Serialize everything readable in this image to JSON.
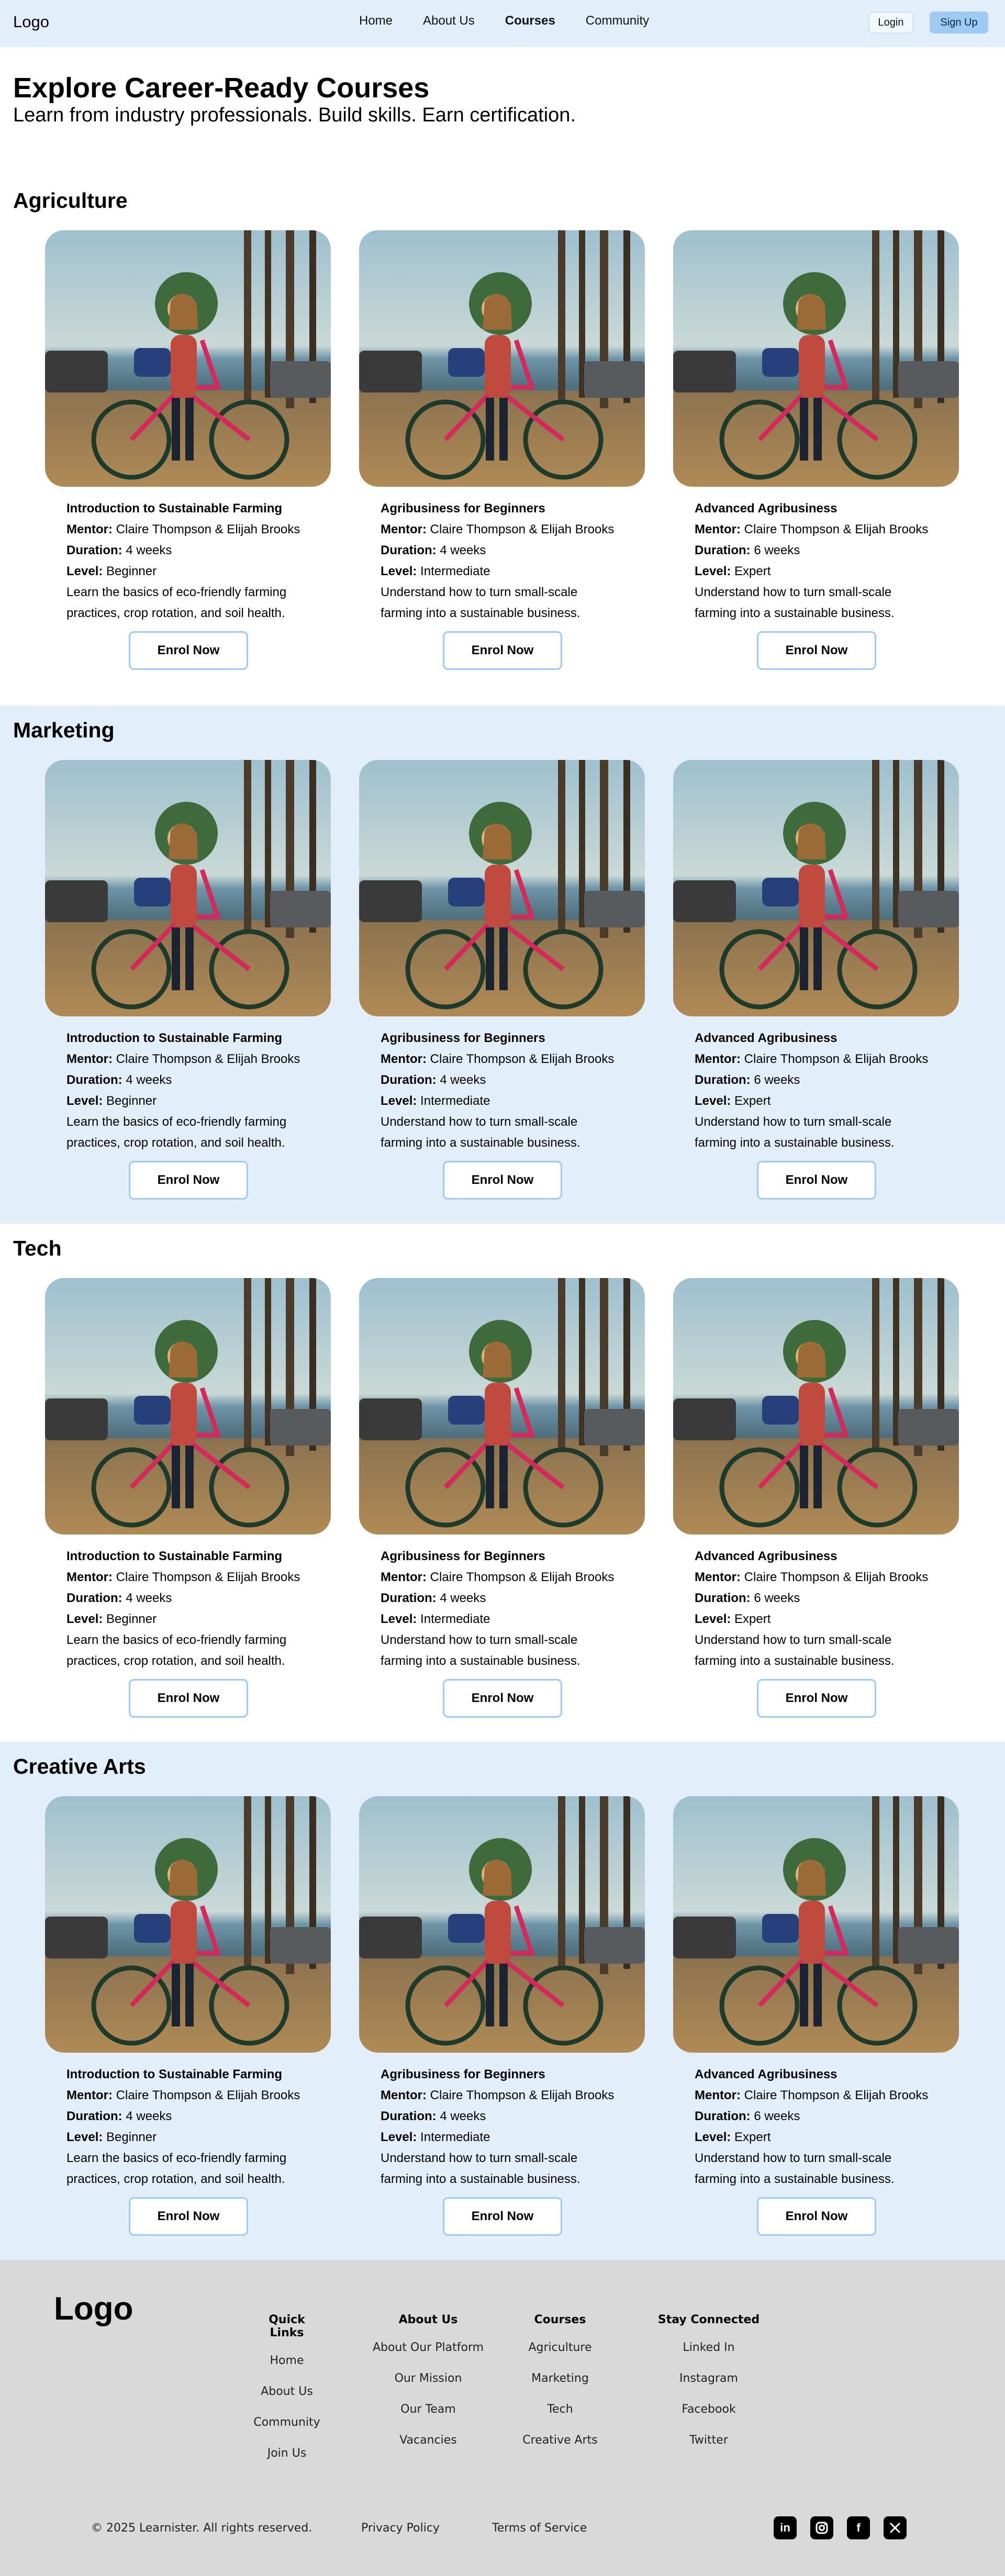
{
  "header": {
    "logo": "Logo",
    "nav": [
      "Home",
      "About Us",
      "Courses",
      "Community"
    ],
    "active_nav": "Courses",
    "login_label": "Login",
    "signup_label": "Sign Up"
  },
  "hero": {
    "title": "Explore Career-Ready Courses",
    "subtitle": "Learn from industry professionals. Build skills. Earn certification."
  },
  "labels": {
    "mentor": "Mentor:",
    "duration": "Duration:",
    "level": "Level:",
    "enrol": "Enrol Now"
  },
  "courses": [
    {
      "title": "Introduction to Sustainable Farming",
      "mentor": "Claire Thompson & Elijah Brooks",
      "duration": "4 weeks",
      "level": "Beginner",
      "desc_line1": "Learn the basics of eco-friendly farming",
      "desc_line2": "practices, crop rotation, and soil health."
    },
    {
      "title": "Agribusiness for Beginners",
      "mentor": "Claire Thompson & Elijah Brooks",
      "duration": "4 weeks",
      "level": "Intermediate",
      "desc_line1": "Understand how to turn small-scale",
      "desc_line2": "farming into a sustainable business."
    },
    {
      "title": "Advanced Agribusiness",
      "mentor": "Claire Thompson & Elijah Brooks",
      "duration": "6 weeks",
      "level": "Expert",
      "desc_line1": "Understand how to turn small-scale",
      "desc_line2": "farming into a sustainable business."
    }
  ],
  "categories": [
    "Agriculture",
    "Marketing",
    "Tech",
    "Creative Arts"
  ],
  "footer": {
    "logo": "Logo",
    "quick_links": {
      "title": "Quick Links",
      "items": [
        "Home",
        "About Us",
        "Community",
        "Join Us"
      ]
    },
    "about_us": {
      "title": "About Us",
      "items": [
        "About Our Platform",
        "Our Mission",
        "Our Team",
        "Vacancies"
      ]
    },
    "courses": {
      "title": "Courses",
      "items": [
        "Agriculture",
        "Marketing",
        "Tech",
        "Creative Arts"
      ]
    },
    "stay_connected": {
      "title": "Stay Connected",
      "items": [
        "Linked In",
        "Instagram",
        "Facebook",
        "Twitter"
      ]
    },
    "copyright": "© 2025 Learnister. All rights reserved.",
    "privacy": "Privacy Policy",
    "terms": "Terms of Service",
    "social_icons": [
      "linkedin-icon",
      "instagram-icon",
      "facebook-icon",
      "x-icon"
    ]
  },
  "colors": {
    "header_bg": "#e3eefb",
    "accent": "#9fcaf4",
    "footer_bg": "#d9d9d9"
  }
}
